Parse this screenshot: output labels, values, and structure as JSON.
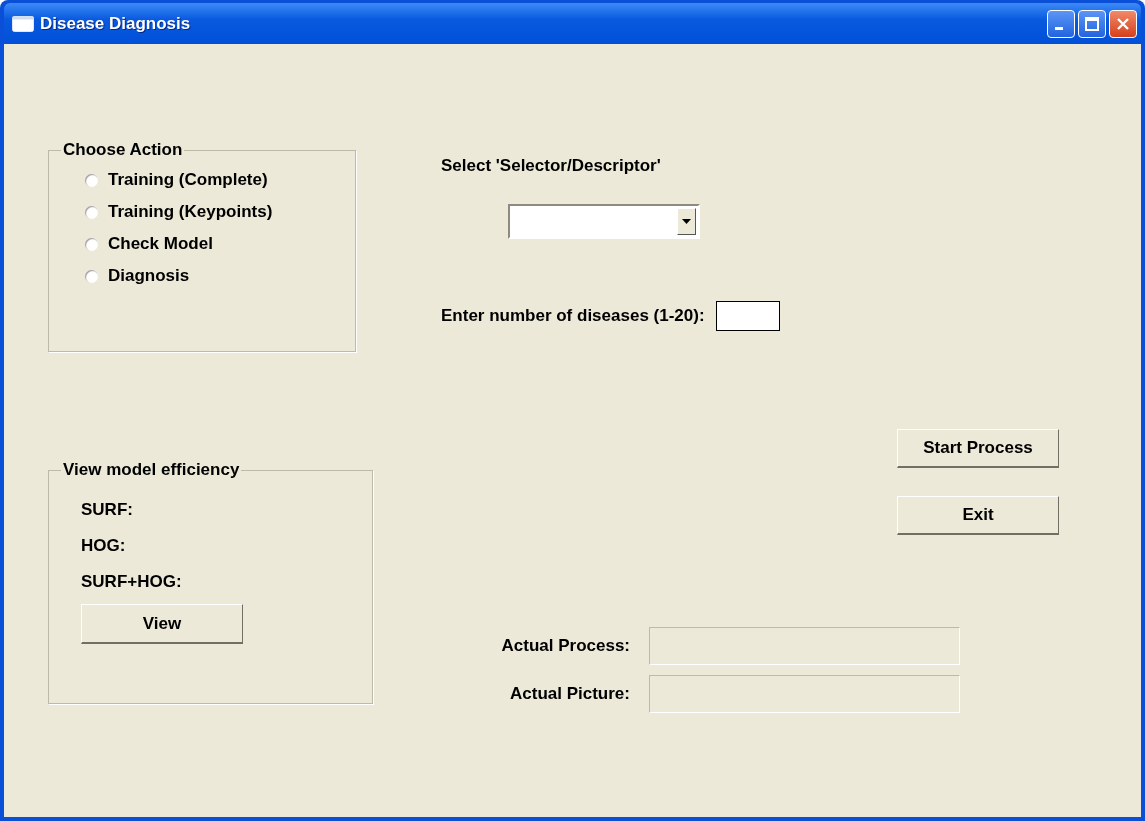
{
  "window": {
    "title": "Disease Diagnosis"
  },
  "choose_action": {
    "title": "Choose Action",
    "options": [
      {
        "label": "Training (Complete)",
        "selected": false
      },
      {
        "label": "Training (Keypoints)",
        "selected": false
      },
      {
        "label": "Check Model",
        "selected": false
      },
      {
        "label": "Diagnosis",
        "selected": false
      }
    ]
  },
  "selector": {
    "label": "Select 'Selector/Descriptor'"
  },
  "diseases": {
    "label": "Enter number of diseases (1-20):"
  },
  "buttons": [
    "Start Process",
    "Exit"
  ],
  "efficiency": {
    "title": "View model efficiency",
    "labels": [
      "SURF:",
      "HOG:",
      "SURF+HOG:"
    ],
    "button": "View"
  },
  "status_fields": [
    {
      "label": "Actual Process:"
    },
    {
      "label": "Actual Picture:"
    }
  ]
}
